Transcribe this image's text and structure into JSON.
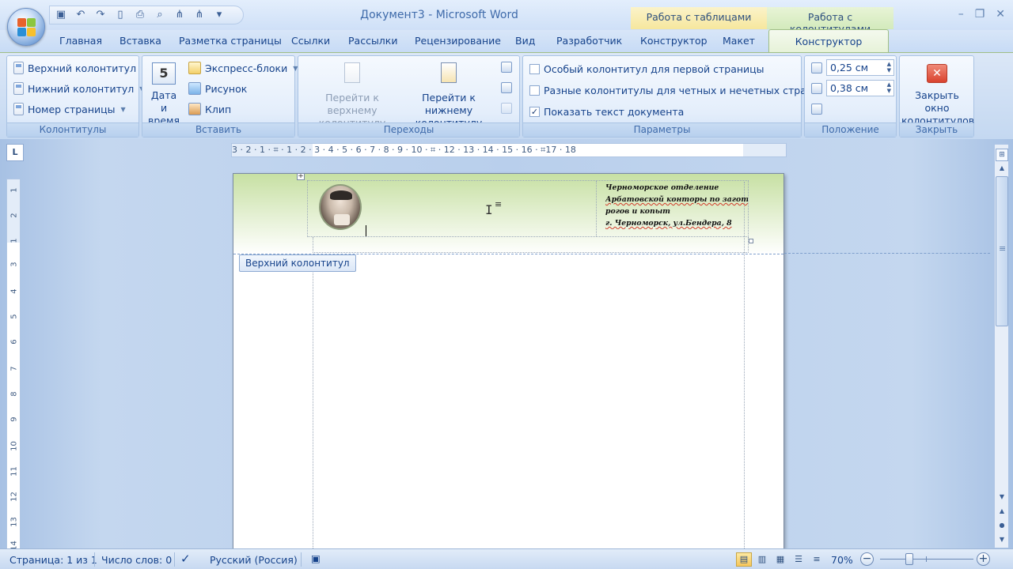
{
  "window": {
    "title": "Документ3 - Microsoft Word",
    "context_tables": "Работа с таблицами",
    "context_headers": "Работа с колонтитулами",
    "minimize": "–",
    "restore": "❐",
    "close": "✕"
  },
  "quick_access": {
    "save_icon": "save-icon",
    "undo_icon": "undo-icon",
    "redo_icon": "redo-icon",
    "new_icon": "new-document-icon",
    "print_icon": "print-icon",
    "preview_icon": "print-preview-icon",
    "customize_icon": "customize-toolbar-icon"
  },
  "tabs": {
    "home": "Главная",
    "insert": "Вставка",
    "page_layout": "Разметка страницы",
    "references": "Ссылки",
    "mailings": "Рассылки",
    "review": "Рецензирование",
    "view": "Вид",
    "developer": "Разработчик",
    "table_design": "Конструктор",
    "table_layout": "Макет",
    "hf_design": "Конструктор"
  },
  "ribbon": {
    "headers_footers": {
      "label": "Колонтитулы",
      "header": "Верхний колонтитул",
      "footer": "Нижний колонтитул",
      "page_number": "Номер страницы"
    },
    "insert": {
      "label": "Вставить",
      "date_time_line1": "Дата и",
      "date_time_line2": "время",
      "quick_parts": "Экспресс-блоки",
      "picture": "Рисунок",
      "clip": "Клип",
      "calendar_number": "5"
    },
    "navigation": {
      "label": "Переходы",
      "go_to_header_line1": "Перейти к верхнему",
      "go_to_header_line2": "колонтитулу",
      "go_to_footer_line1": "Перейти к нижнему",
      "go_to_footer_line2": "колонтитулу"
    },
    "options": {
      "label": "Параметры",
      "different_first": "Особый колонтитул для первой страницы",
      "different_odd_even": "Разные колонтитулы для четных и нечетных страниц",
      "show_document_text": "Показать текст документа",
      "different_first_checked": false,
      "different_odd_even_checked": false,
      "show_document_text_checked": true
    },
    "position": {
      "label": "Положение",
      "header_from_top": "0,25 см",
      "footer_from_bottom": "0,38 см"
    },
    "close": {
      "label": "Закрыть",
      "button_line1": "Закрыть окно",
      "button_line2": "колонтитулов"
    }
  },
  "ruler": {
    "horizontal": "3 · 2 · 1 · ⌗ · 1 · 2 · 3 · 4 · 5 · 6 · 7 · 8 · 9 · 10 · ⌗ · 12 · 13 · 14 · 15 · 16 · ⌗17 · 18",
    "tab_selector": "L",
    "vertical_numbers": [
      "1",
      "2",
      "1",
      "3",
      "4",
      "5",
      "6",
      "7",
      "8",
      "9",
      "10",
      "11",
      "12",
      "13",
      "14"
    ]
  },
  "document": {
    "header_label": "Верхний колонтитул",
    "address_line1": "Черноморское отделение",
    "address_line2": "Арбатовской конторы по заготовке",
    "address_line3": "рогов и копыт",
    "address_line4": "г. Черноморск, ул.Бендера, 8"
  },
  "status": {
    "page": "Страница: 1 из 1",
    "words": "Число слов: 0",
    "language": "Русский (Россия)",
    "zoom": "70%"
  },
  "colors": {
    "ribbon_text": "#15428b",
    "header_band_top": "#c7e0a3",
    "context_tables": "#f6e79e",
    "context_headers": "#d3eabc"
  }
}
